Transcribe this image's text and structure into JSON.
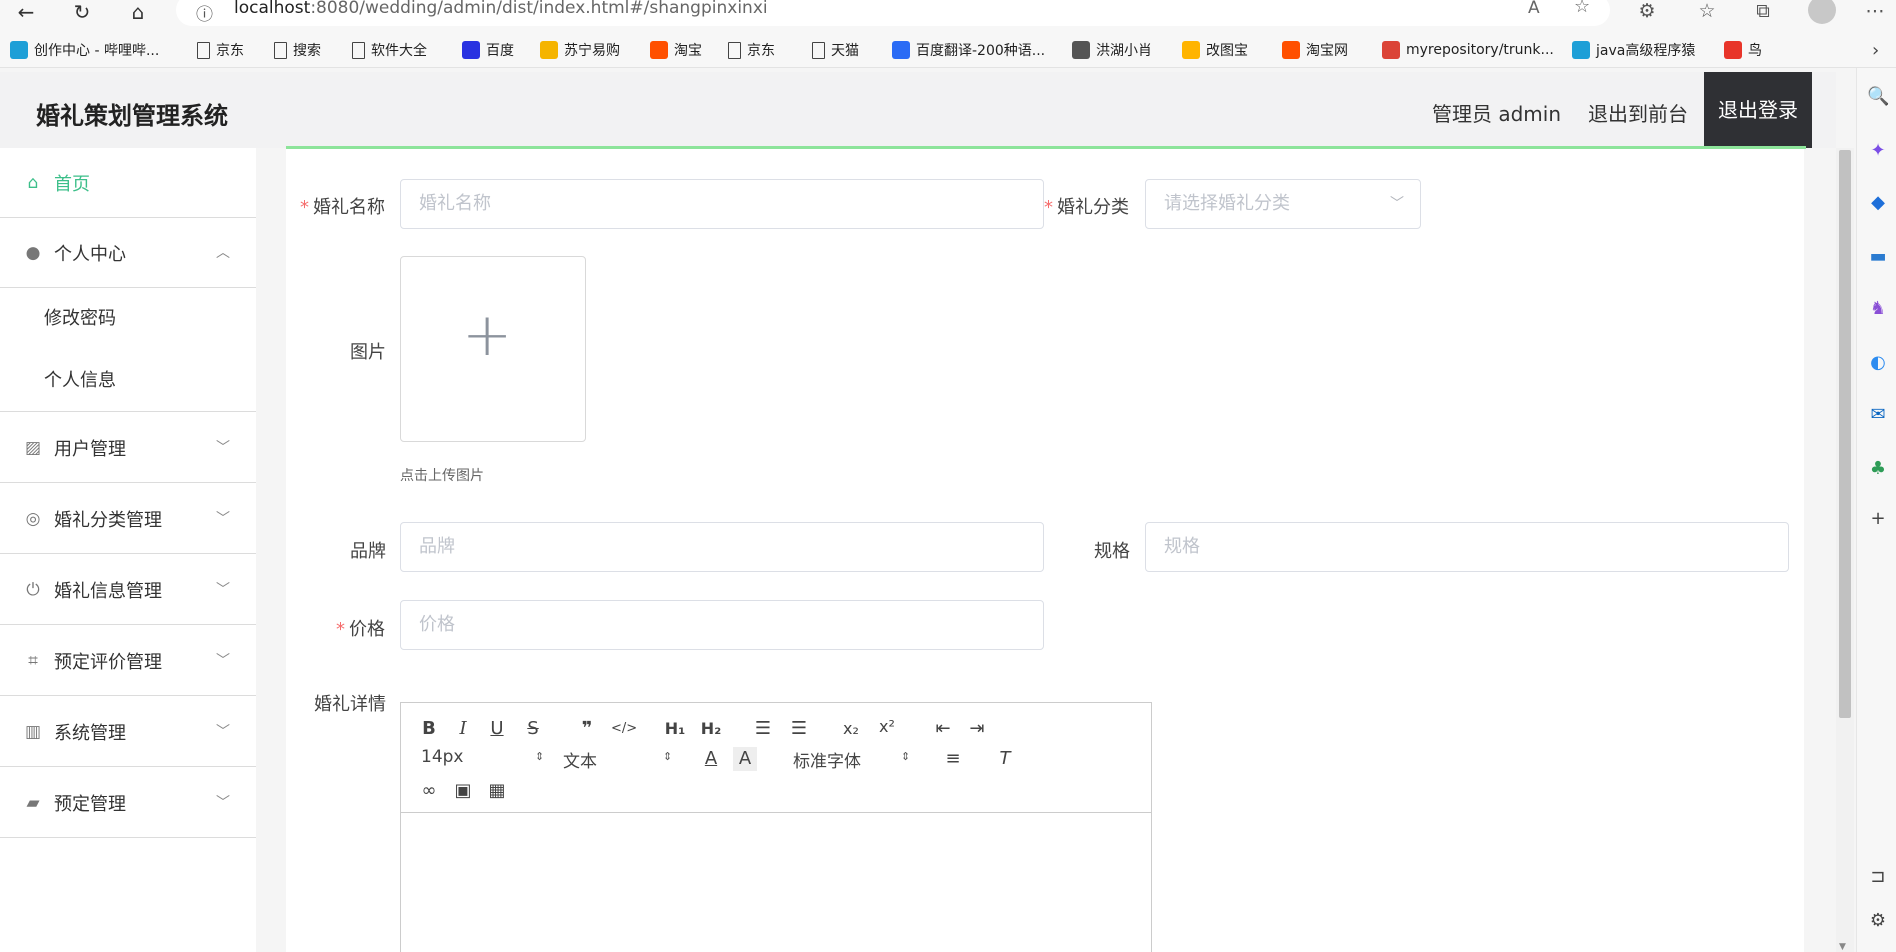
{
  "browser": {
    "url_host": "localhost",
    "url_path": ":8080/wedding/admin/dist/index.html#/shangpinxinxi",
    "bookmarks": [
      {
        "label": "创作中心 - 哔哩哔...",
        "icon": "bilibili-icon",
        "color": "#1e9fd7"
      },
      {
        "label": "京东",
        "icon": "page-icon"
      },
      {
        "label": "搜索",
        "icon": "page-icon"
      },
      {
        "label": "软件大全",
        "icon": "page-icon"
      },
      {
        "label": "百度",
        "icon": "baidu-paw-icon",
        "color": "#2932e1"
      },
      {
        "label": "苏宁易购",
        "icon": "suning-icon",
        "color": "#f5b400"
      },
      {
        "label": "淘宝",
        "icon": "taobao-icon",
        "color": "#ff5000"
      },
      {
        "label": "京东",
        "icon": "page-icon"
      },
      {
        "label": "天猫",
        "icon": "page-icon"
      },
      {
        "label": "百度翻译-200种语...",
        "icon": "baidu-translate-icon",
        "color": "#2a6bf5"
      },
      {
        "label": "洪湖小肖",
        "icon": "bird-icon",
        "color": "#555555"
      },
      {
        "label": "改图宝",
        "icon": "gaitubao-icon",
        "color": "#ffb400"
      },
      {
        "label": "淘宝网",
        "icon": "taobao-icon",
        "color": "#ff5000"
      },
      {
        "label": "myrepository/trunk...",
        "icon": "chrome-icon",
        "color": "#db4437"
      },
      {
        "label": "java高级程序猿",
        "icon": "bilibili-icon",
        "color": "#1e9fd7"
      },
      {
        "label": "鸟",
        "icon": "feishu-bird-icon",
        "color": "#e8352a"
      }
    ]
  },
  "header": {
    "title": "婚礼策划管理系统",
    "admin_label": "管理员 admin",
    "front_label": "退出到前台",
    "logout_label": "退出登录"
  },
  "sidebar": {
    "items": [
      {
        "label": "首页",
        "icon": "home-icon",
        "active": true
      },
      {
        "label": "个人中心",
        "icon": "user-icon",
        "expanded": true
      },
      {
        "label": "用户管理",
        "icon": "chart-icon"
      },
      {
        "label": "婚礼分类管理",
        "icon": "compass-icon"
      },
      {
        "label": "婚礼信息管理",
        "icon": "power-icon"
      },
      {
        "label": "预定评价管理",
        "icon": "crop-icon"
      },
      {
        "label": "系统管理",
        "icon": "bar-chart-icon"
      },
      {
        "label": "预定管理",
        "icon": "wallet-icon"
      }
    ],
    "sub_items": [
      "修改密码",
      "个人信息"
    ]
  },
  "form": {
    "name_label": "婚礼名称",
    "name_placeholder": "婚礼名称",
    "category_label": "婚礼分类",
    "category_placeholder": "请选择婚礼分类",
    "image_label": "图片",
    "upload_tip": "点击上传图片",
    "brand_label": "品牌",
    "brand_placeholder": "品牌",
    "spec_label": "规格",
    "spec_placeholder": "规格",
    "price_label": "价格",
    "price_placeholder": "价格",
    "detail_label": "婚礼详情"
  },
  "editor": {
    "font_size": "14px",
    "block_type": "文本",
    "font_family": "标准字体"
  },
  "colors": {
    "accent": "#3dbf8a",
    "required": "#f56c6c",
    "logout_bg": "#2f3034"
  }
}
